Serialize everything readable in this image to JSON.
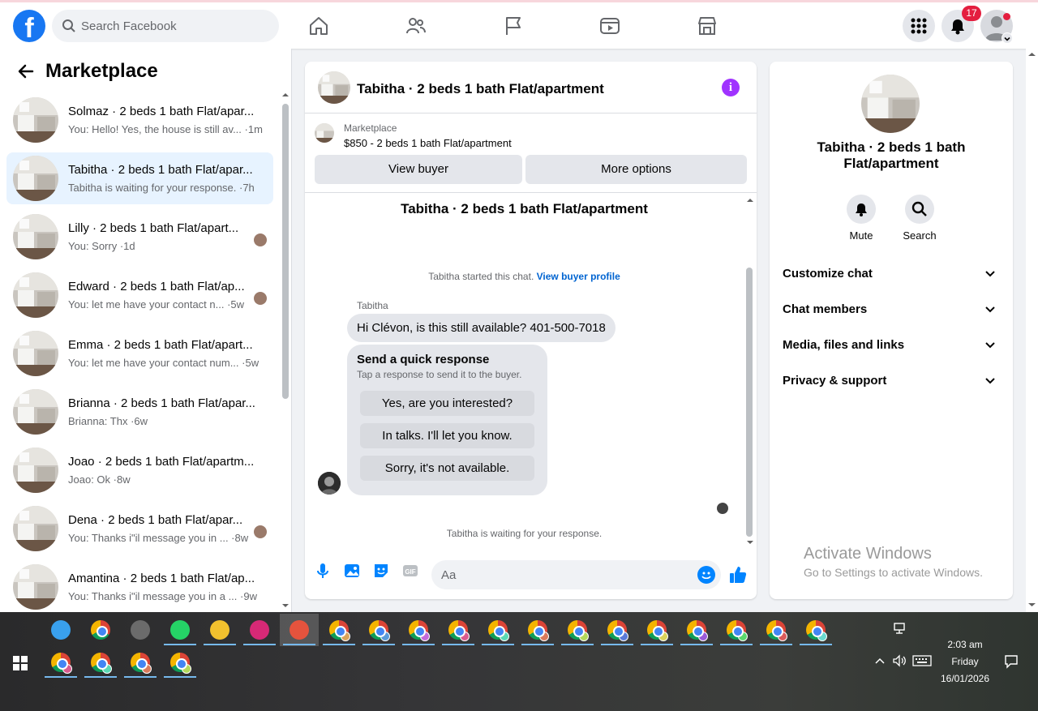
{
  "topnav": {
    "logo": "facebook-logo",
    "search_placeholder": "Search Facebook",
    "notifications_count": "17",
    "icons": [
      "home-icon",
      "friends-icon",
      "pages-flag-icon",
      "watch-icon",
      "marketplace-icon",
      "menu-grid-icon",
      "bell-icon"
    ]
  },
  "sidebar": {
    "title": "Marketplace",
    "conversations": [
      {
        "title": "Solmaz · 2 beds 1 bath Flat/apar...",
        "preview": "You: Hello! Yes, the house is still av... ·1m",
        "active": false,
        "has_avatar": false
      },
      {
        "title": "Tabitha · 2 beds 1 bath Flat/apar...",
        "preview": "Tabitha is waiting for your response. ·7h",
        "active": true,
        "has_avatar": false
      },
      {
        "title": "Lilly · 2 beds 1 bath Flat/apart...",
        "preview": "You: Sorry ·1d",
        "active": false,
        "has_avatar": true
      },
      {
        "title": "Edward · 2 beds 1 bath Flat/ap...",
        "preview": "You: let me have your contact n... ·5w",
        "active": false,
        "has_avatar": true
      },
      {
        "title": "Emma · 2 beds 1 bath Flat/apart...",
        "preview": "You: let me have your contact num... ·5w",
        "active": false,
        "has_avatar": false
      },
      {
        "title": "Brianna · 2 beds 1 bath Flat/apar...",
        "preview": "Brianna: Thx ·6w",
        "active": false,
        "has_avatar": false
      },
      {
        "title": "Joao · 2 beds 1 bath Flat/apartm...",
        "preview": "Joao: Ok ·8w",
        "active": false,
        "has_avatar": false
      },
      {
        "title": "Dena · 2 beds 1 bath Flat/apar...",
        "preview": "You: Thanks i\"il message you in ... ·8w",
        "active": false,
        "has_avatar": true
      },
      {
        "title": "Amantina · 2 beds 1 bath Flat/ap...",
        "preview": "You: Thanks i\"il message you in a ... ·9w",
        "active": false,
        "has_avatar": false
      }
    ]
  },
  "chat": {
    "header_title": "Tabitha · 2 beds 1 bath Flat/apartment",
    "marketplace_label": "Marketplace",
    "listing": "$850 - 2 beds 1 bath Flat/apartment",
    "view_buyer": "View buyer",
    "more_options": "More options",
    "thread_title": "Tabitha · 2 beds 1 bath Flat/apartment",
    "started_text": "Tabitha started this chat.",
    "view_buyer_profile": "View buyer profile",
    "sender": "Tabitha",
    "message": "Hi Clévon, is this still available? 401-500-7018",
    "quick_title": "Send a quick response",
    "quick_subtitle": "Tap a response to send it to the buyer.",
    "quick_options": [
      "Yes, are you interested?",
      "In talks. I'll let you know.",
      "Sorry, it's not available."
    ],
    "waiting_text": "Tabitha is waiting for your response.",
    "composer_placeholder": "Aa"
  },
  "info_panel": {
    "title": "Tabitha · 2 beds 1 bath Flat/apartment",
    "mute": "Mute",
    "search": "Search",
    "sections": [
      "Customize chat",
      "Chat members",
      "Media, files and links",
      "Privacy & support"
    ]
  },
  "watermark": {
    "line1": "Activate Windows",
    "line2": "Go to Settings to activate Windows."
  },
  "taskbar": {
    "time": "2:03 am",
    "day": "Friday",
    "date": "16/01/2026",
    "accent": "#76b9ed"
  }
}
